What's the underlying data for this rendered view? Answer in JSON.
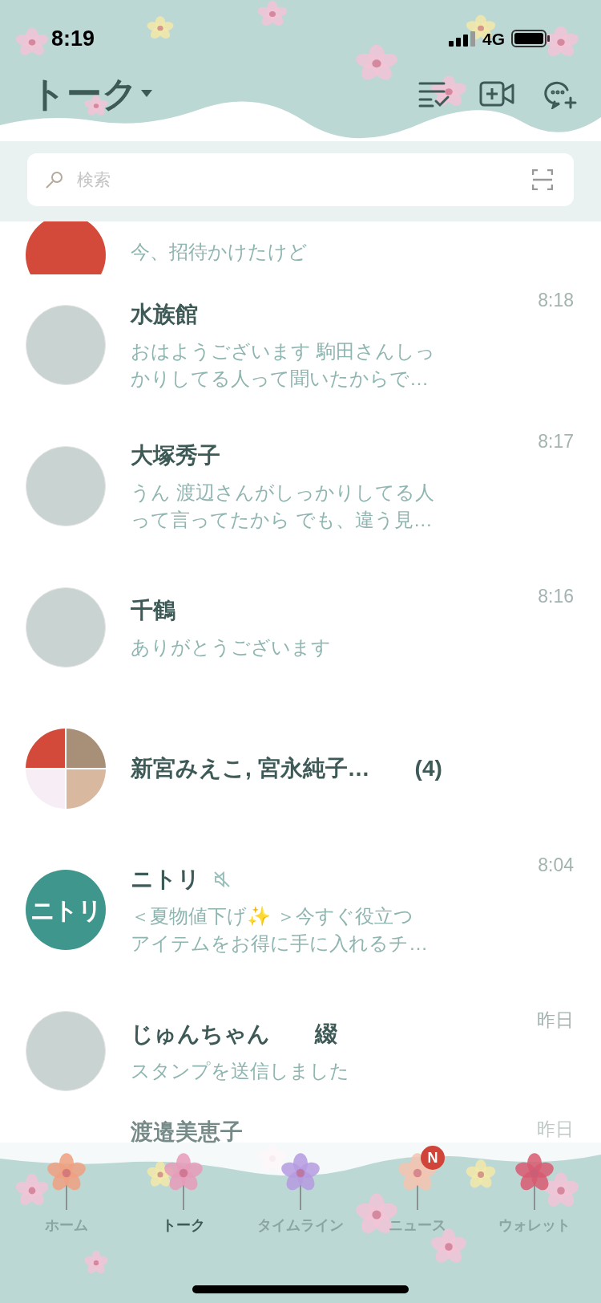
{
  "status_bar": {
    "time": "8:19",
    "network": "4G"
  },
  "header": {
    "title": "トーク"
  },
  "search": {
    "placeholder": "検索"
  },
  "partial_row": {
    "preview": "今、招待かけたけど"
  },
  "chats": [
    {
      "kind": "single",
      "name": "水族館",
      "time": "8:18",
      "preview": [
        "おはようございます 駒田さんしっ",
        "かりしてる人って聞いたからで…"
      ],
      "muted": false
    },
    {
      "kind": "single",
      "name": "大塚秀子",
      "time": "8:17",
      "preview": [
        "うん 渡辺さんがしっかりしてる人",
        "って言ってたから でも、違う見…"
      ],
      "muted": false
    },
    {
      "kind": "single",
      "name": "千鶴",
      "time": "8:16",
      "preview": [
        "ありがとうございます"
      ],
      "muted": false
    },
    {
      "kind": "group",
      "name": "新宮みえこ, 宮永純子…",
      "count": "(4)",
      "muted": false
    },
    {
      "kind": "logo",
      "name": "ニトリ",
      "time": "8:04",
      "preview": [
        "＜夏物値下げ✨ ＞今すぐ役立つ",
        "アイテムをお得に手に入れるチ…"
      ],
      "muted": true,
      "avatar_text": "ニトリ"
    },
    {
      "kind": "single",
      "name": "じゅんちゃん　　綴",
      "time": "昨日",
      "preview": [
        "スタンプを送信しました"
      ],
      "muted": false
    }
  ],
  "faded_row": {
    "name": "渡邉美恵子",
    "time": "昨日"
  },
  "tabs": [
    {
      "label": "ホーム",
      "selected": false
    },
    {
      "label": "トーク",
      "selected": true
    },
    {
      "label": "タイムライン",
      "selected": false
    },
    {
      "label": "ニュース",
      "selected": false,
      "badge": "N"
    },
    {
      "label": "ウォレット",
      "selected": false
    }
  ]
}
